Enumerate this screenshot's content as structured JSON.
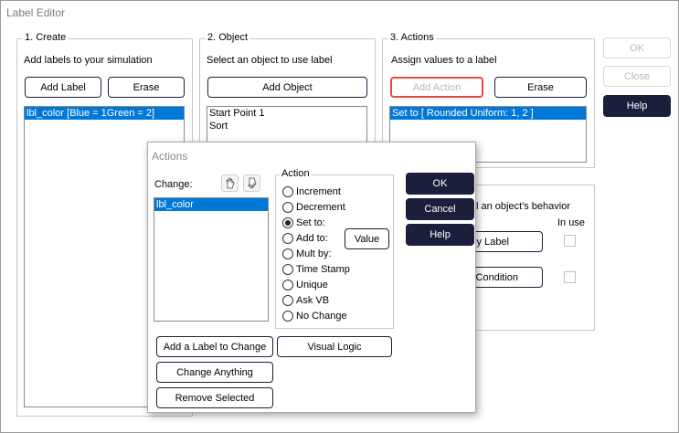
{
  "window": {
    "title": "Label Editor"
  },
  "create": {
    "title": "1. Create",
    "description": "Add labels to your simulation",
    "add_label": "Add Label",
    "erase": "Erase",
    "items": [
      "lbl_color   [Blue = 1Green = 2]"
    ]
  },
  "object": {
    "title": "2. Object",
    "description": "Select an object to use label",
    "add_object": "Add Object",
    "items": [
      "Start Point 1",
      "Sort"
    ]
  },
  "actions": {
    "title": "3. Actions",
    "description": "Assign values to a label",
    "add_action": "Add Action",
    "erase": "Erase",
    "items": [
      "Set to    [ Rounded Uniform: 1, 2 ]"
    ]
  },
  "behavior": {
    "partial_text": "l an object's behavior",
    "in_use": "In use",
    "by_label_partial": "by Label",
    "condition_partial": "Condition"
  },
  "side": {
    "ok": "OK",
    "close": "Close",
    "help": "Help"
  },
  "dialog": {
    "title": "Actions",
    "change_label": "Change:",
    "change_items": [
      "lbl_color"
    ],
    "action_group": "Action",
    "options": [
      "Increment",
      "Decrement",
      "Set to:",
      "Add to:",
      "Mult by:",
      "Time Stamp",
      "Unique",
      "Ask VB",
      "No Change"
    ],
    "selected_option": "Set to:",
    "value_button": "Value",
    "ok": "OK",
    "cancel": "Cancel",
    "help": "Help",
    "add_label_to_change": "Add a Label to Change",
    "visual_logic": "Visual Logic",
    "change_anything": "Change Anything",
    "remove_selected": "Remove Selected",
    "icons": [
      "hand-up-icon",
      "hand-down-icon"
    ]
  },
  "colors": {
    "dark_button": "#1b1f3b",
    "selection": "#0078d7",
    "highlight_border": "#e8483e"
  }
}
